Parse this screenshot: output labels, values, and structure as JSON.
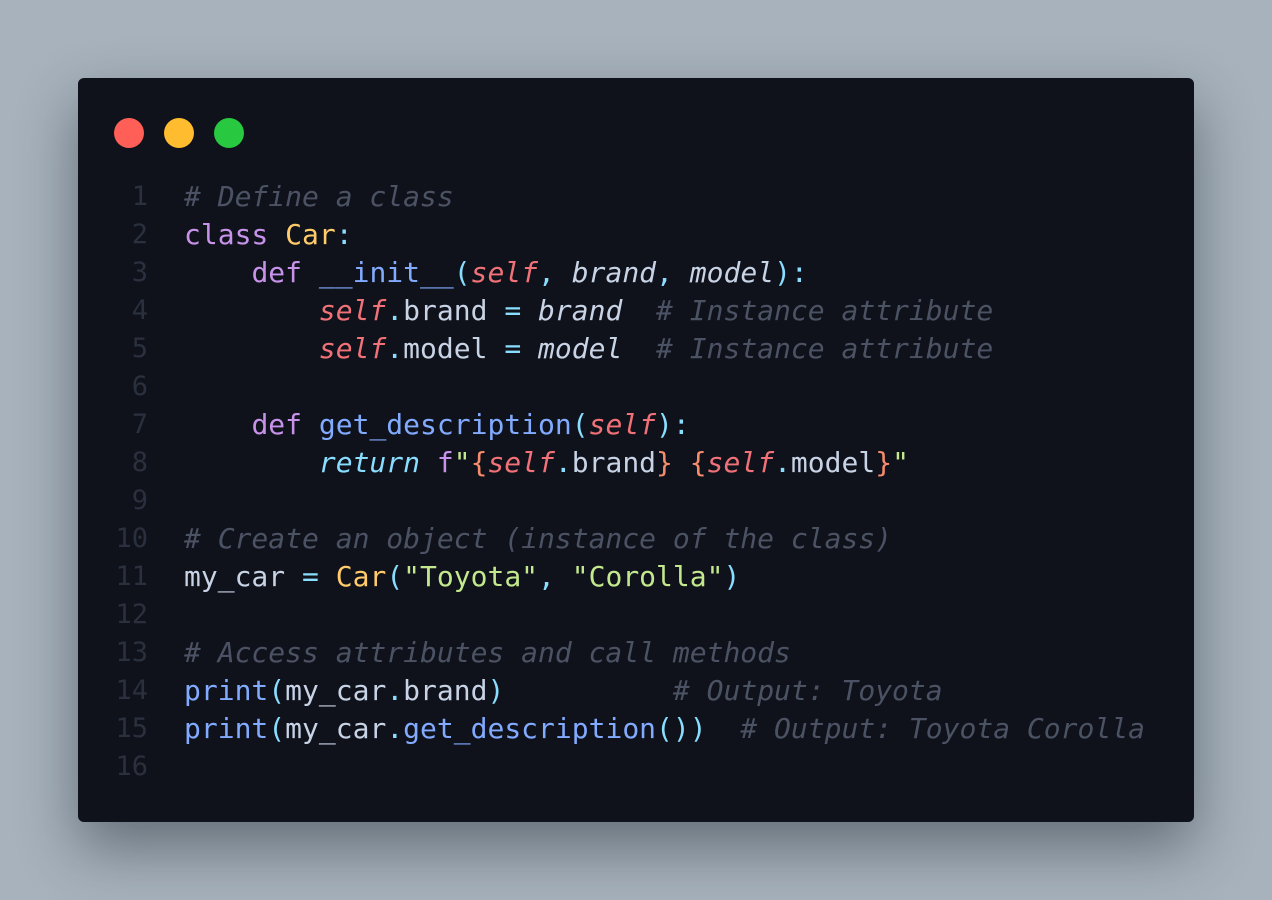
{
  "window": {
    "buttons": [
      "close",
      "minimize",
      "maximize"
    ],
    "colors": {
      "background": "#0f121a",
      "close": "#ff5f57",
      "minimize": "#febc2e",
      "maximize": "#28c840"
    }
  },
  "code": {
    "language": "python",
    "lines": [
      {
        "number": "1",
        "tokens": [
          {
            "text": "# Define a class",
            "type": "comment"
          }
        ]
      },
      {
        "number": "2",
        "tokens": [
          {
            "text": "class",
            "type": "kw"
          },
          {
            "text": " ",
            "type": "plain"
          },
          {
            "text": "Car",
            "type": "cls"
          },
          {
            "text": ":",
            "type": "punc"
          }
        ]
      },
      {
        "number": "3",
        "tokens": [
          {
            "text": "    ",
            "type": "plain"
          },
          {
            "text": "def",
            "type": "kw"
          },
          {
            "text": " ",
            "type": "plain"
          },
          {
            "text": "__init__",
            "type": "fn"
          },
          {
            "text": "(",
            "type": "punc"
          },
          {
            "text": "self",
            "type": "self"
          },
          {
            "text": ", ",
            "type": "punc"
          },
          {
            "text": "brand",
            "type": "param"
          },
          {
            "text": ", ",
            "type": "punc"
          },
          {
            "text": "model",
            "type": "param"
          },
          {
            "text": "):",
            "type": "punc"
          }
        ]
      },
      {
        "number": "4",
        "tokens": [
          {
            "text": "        ",
            "type": "plain"
          },
          {
            "text": "self",
            "type": "self"
          },
          {
            "text": ".",
            "type": "punc"
          },
          {
            "text": "brand",
            "type": "plain"
          },
          {
            "text": " ",
            "type": "plain"
          },
          {
            "text": "=",
            "type": "op"
          },
          {
            "text": " ",
            "type": "plain"
          },
          {
            "text": "brand",
            "type": "param"
          },
          {
            "text": "  ",
            "type": "plain"
          },
          {
            "text": "# Instance attribute",
            "type": "comment"
          }
        ]
      },
      {
        "number": "5",
        "tokens": [
          {
            "text": "        ",
            "type": "plain"
          },
          {
            "text": "self",
            "type": "self"
          },
          {
            "text": ".",
            "type": "punc"
          },
          {
            "text": "model",
            "type": "plain"
          },
          {
            "text": " ",
            "type": "plain"
          },
          {
            "text": "=",
            "type": "op"
          },
          {
            "text": " ",
            "type": "plain"
          },
          {
            "text": "model",
            "type": "param"
          },
          {
            "text": "  ",
            "type": "plain"
          },
          {
            "text": "# Instance attribute",
            "type": "comment"
          }
        ]
      },
      {
        "number": "6",
        "tokens": []
      },
      {
        "number": "7",
        "tokens": [
          {
            "text": "    ",
            "type": "plain"
          },
          {
            "text": "def",
            "type": "kw"
          },
          {
            "text": " ",
            "type": "plain"
          },
          {
            "text": "get_description",
            "type": "fn"
          },
          {
            "text": "(",
            "type": "punc"
          },
          {
            "text": "self",
            "type": "self"
          },
          {
            "text": "):",
            "type": "punc"
          }
        ]
      },
      {
        "number": "8",
        "tokens": [
          {
            "text": "        ",
            "type": "plain"
          },
          {
            "text": "return",
            "type": "ret"
          },
          {
            "text": " ",
            "type": "plain"
          },
          {
            "text": "f",
            "type": "kw"
          },
          {
            "text": "\"",
            "type": "str"
          },
          {
            "text": "{",
            "type": "fstr"
          },
          {
            "text": "self",
            "type": "self"
          },
          {
            "text": ".",
            "type": "punc"
          },
          {
            "text": "brand",
            "type": "plain"
          },
          {
            "text": "}",
            "type": "fstr"
          },
          {
            "text": " ",
            "type": "str"
          },
          {
            "text": "{",
            "type": "fstr"
          },
          {
            "text": "self",
            "type": "self"
          },
          {
            "text": ".",
            "type": "punc"
          },
          {
            "text": "model",
            "type": "plain"
          },
          {
            "text": "}",
            "type": "fstr"
          },
          {
            "text": "\"",
            "type": "str"
          }
        ]
      },
      {
        "number": "9",
        "tokens": []
      },
      {
        "number": "10",
        "tokens": [
          {
            "text": "# Create an object (instance of the class)",
            "type": "comment"
          }
        ]
      },
      {
        "number": "11",
        "tokens": [
          {
            "text": "my_car",
            "type": "plain"
          },
          {
            "text": " ",
            "type": "plain"
          },
          {
            "text": "=",
            "type": "op"
          },
          {
            "text": " ",
            "type": "plain"
          },
          {
            "text": "Car",
            "type": "cls"
          },
          {
            "text": "(",
            "type": "punc"
          },
          {
            "text": "\"Toyota\"",
            "type": "str"
          },
          {
            "text": ", ",
            "type": "punc"
          },
          {
            "text": "\"Corolla\"",
            "type": "str"
          },
          {
            "text": ")",
            "type": "punc"
          }
        ]
      },
      {
        "number": "12",
        "tokens": []
      },
      {
        "number": "13",
        "tokens": [
          {
            "text": "# Access attributes and call methods",
            "type": "comment"
          }
        ]
      },
      {
        "number": "14",
        "tokens": [
          {
            "text": "print",
            "type": "fn"
          },
          {
            "text": "(",
            "type": "punc"
          },
          {
            "text": "my_car",
            "type": "plain"
          },
          {
            "text": ".",
            "type": "punc"
          },
          {
            "text": "brand",
            "type": "plain"
          },
          {
            "text": ")",
            "type": "punc"
          },
          {
            "text": "          ",
            "type": "plain"
          },
          {
            "text": "# Output: Toyota",
            "type": "comment"
          }
        ]
      },
      {
        "number": "15",
        "tokens": [
          {
            "text": "print",
            "type": "fn"
          },
          {
            "text": "(",
            "type": "punc"
          },
          {
            "text": "my_car",
            "type": "plain"
          },
          {
            "text": ".",
            "type": "punc"
          },
          {
            "text": "get_description",
            "type": "fn"
          },
          {
            "text": "())",
            "type": "punc"
          },
          {
            "text": "  ",
            "type": "plain"
          },
          {
            "text": "# Output: Toyota Corolla",
            "type": "comment"
          }
        ]
      },
      {
        "number": "16",
        "tokens": []
      }
    ]
  }
}
